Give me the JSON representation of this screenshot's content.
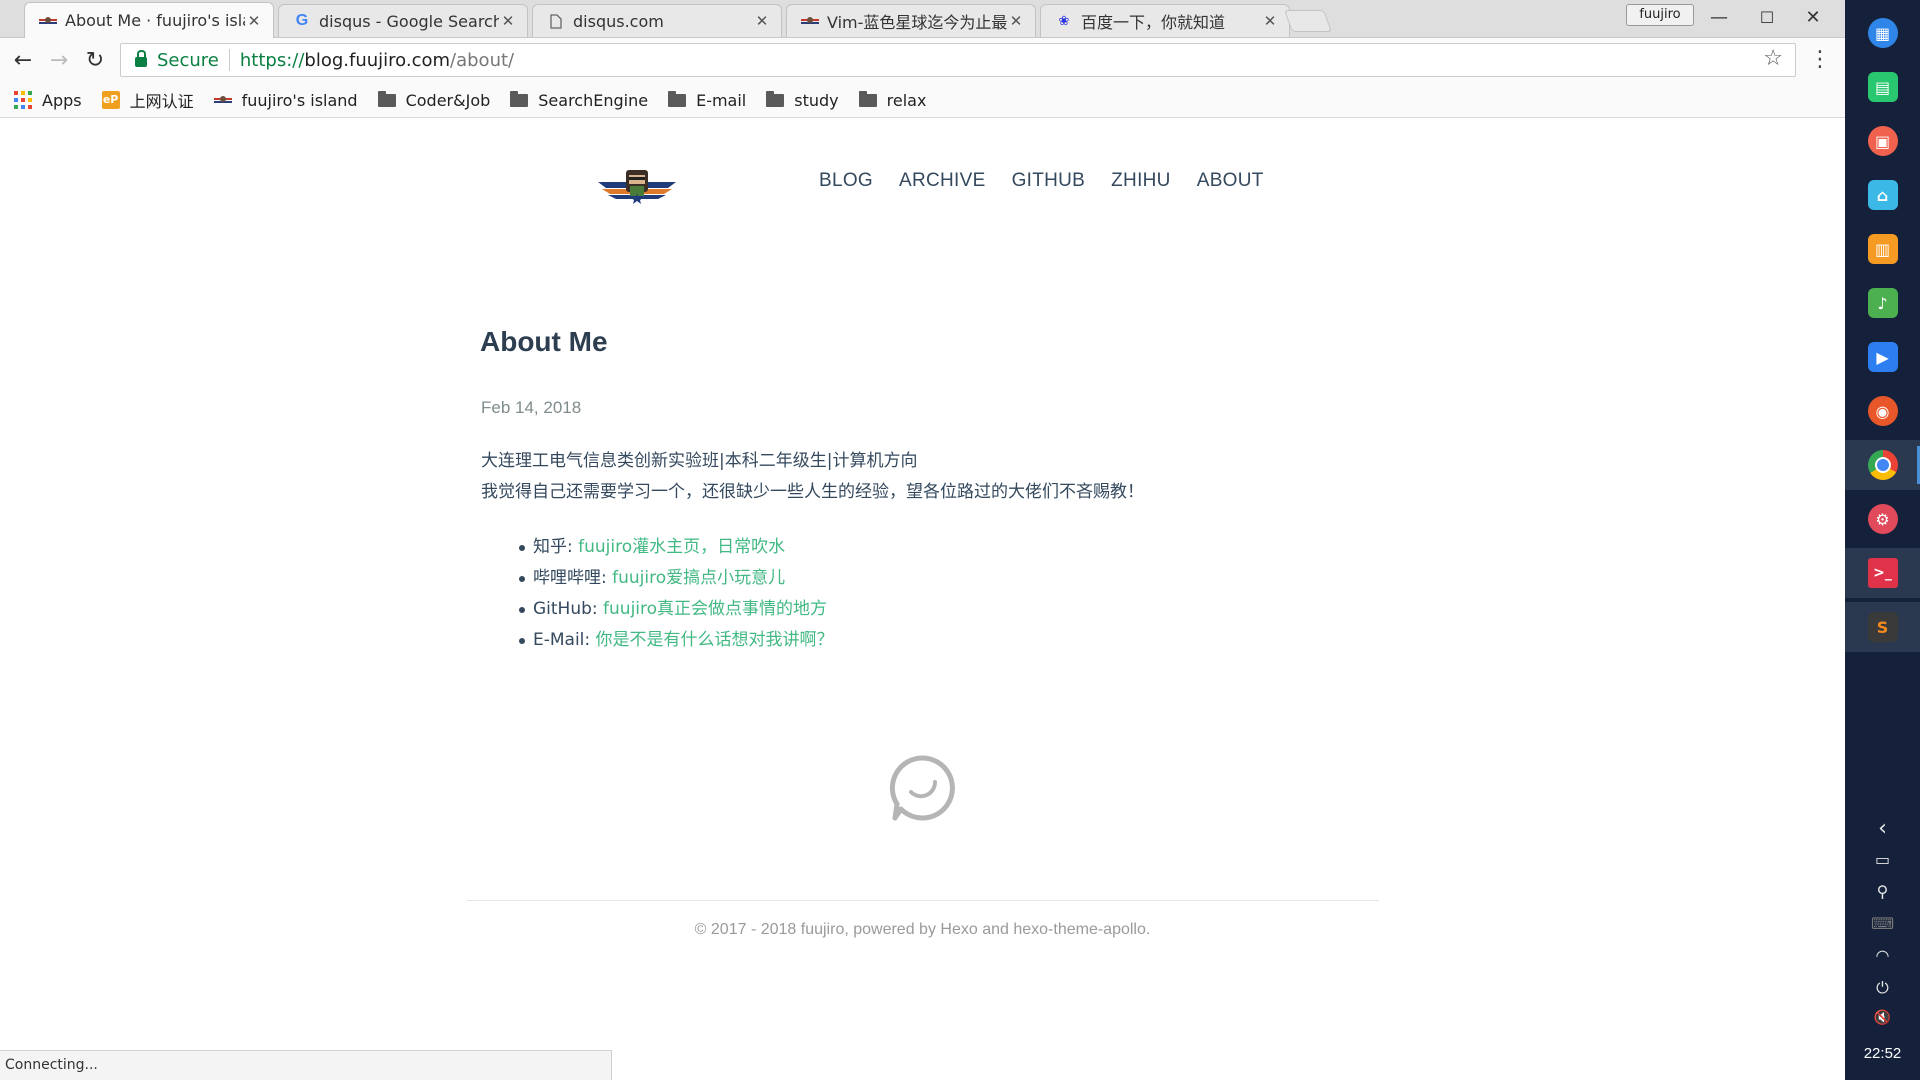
{
  "browser": {
    "tabs": [
      {
        "title": "About Me · fuujiro's island",
        "active": true
      },
      {
        "title": "disqus - Google Search",
        "active": false
      },
      {
        "title": "disqus.com",
        "active": false
      },
      {
        "title": "Vim-蓝色星球迄今为止最",
        "active": false
      },
      {
        "title": "百度一下，你就知道",
        "active": false
      }
    ],
    "profile_name": "fuujiro",
    "window_controls": {
      "minimize": "—",
      "maximize": "☐",
      "close": "✕"
    },
    "nav": {
      "back": "←",
      "forward": "→",
      "reload": "↻"
    },
    "address": {
      "security_label": "Secure",
      "scheme": "https://",
      "host": "blog.fuujiro.com",
      "path": "/about/"
    },
    "bookmarks": [
      {
        "label": "Apps",
        "icon": "apps-grid-icon"
      },
      {
        "label": "上网认证",
        "icon": "ep-icon"
      },
      {
        "label": "fuujiro's island",
        "icon": "site-favicon-icon"
      },
      {
        "label": "Coder&Job",
        "icon": "folder-icon"
      },
      {
        "label": "SearchEngine",
        "icon": "folder-icon"
      },
      {
        "label": "E-mail",
        "icon": "folder-icon"
      },
      {
        "label": "study",
        "icon": "folder-icon"
      },
      {
        "label": "relax",
        "icon": "folder-icon"
      }
    ],
    "status_text": "Connecting..."
  },
  "site": {
    "nav": [
      "BLOG",
      "ARCHIVE",
      "GITHUB",
      "ZHIHU",
      "ABOUT"
    ]
  },
  "post": {
    "title": "About Me",
    "date": "Feb 14, 2018",
    "intro_lines": [
      "大连理工电气信息类创新实验班|本科二年级生|计算机方向",
      "我觉得自己还需要学习一个，还很缺少一些人生的经验，望各位路过的大佬们不吝赐教！"
    ],
    "links": [
      {
        "label": "知乎: ",
        "text": "fuujiro灌水主页，日常吹水"
      },
      {
        "label": "哔哩哔哩: ",
        "text": "fuujiro爱搞点小玩意儿"
      },
      {
        "label": "GitHub: ",
        "text": "fuujiro真正会做点事情的地方"
      },
      {
        "label": "E-Mail: ",
        "text": "你是不是有什么话想对我讲啊？"
      }
    ]
  },
  "footer": {
    "prefix": "© 2017 - 2018 fuujiro, powered by ",
    "hexo": "Hexo",
    "and": " and ",
    "theme": "hexo-theme-apollo",
    "suffix": "."
  },
  "dock": {
    "apps": [
      {
        "name": "launcher-icon",
        "color": "#2f86e8"
      },
      {
        "name": "terminal-green-icon",
        "color": "#29c76f"
      },
      {
        "name": "screen-recorder-icon",
        "color": "#f0624d"
      },
      {
        "name": "app-store-icon",
        "color": "#3bb8e6"
      },
      {
        "name": "archive-manager-icon",
        "color": "#f59a23"
      },
      {
        "name": "music-player-icon",
        "color": "#4caf50"
      },
      {
        "name": "video-player-icon",
        "color": "#2d7ef0"
      },
      {
        "name": "firefox-icon",
        "color": "#e8572a"
      },
      {
        "name": "chrome-icon",
        "color": "#4285f4"
      },
      {
        "name": "settings-icon",
        "color": "#e04a5a"
      },
      {
        "name": "deepin-terminal-icon",
        "color": "#e0334a"
      },
      {
        "name": "sublime-text-icon",
        "color": "#f58a1f"
      }
    ],
    "tray": [
      {
        "name": "collapse-arrow-icon",
        "glyph": "‹"
      },
      {
        "name": "battery-icon",
        "glyph": "▭"
      },
      {
        "name": "usb-icon",
        "glyph": "⚲"
      },
      {
        "name": "keyboard-icon",
        "glyph": "⌨"
      },
      {
        "name": "wifi-icon",
        "glyph": "◠"
      },
      {
        "name": "power-icon",
        "glyph": "⏻"
      },
      {
        "name": "volume-mute-icon",
        "glyph": "🔇"
      }
    ],
    "clock": "22:52"
  }
}
